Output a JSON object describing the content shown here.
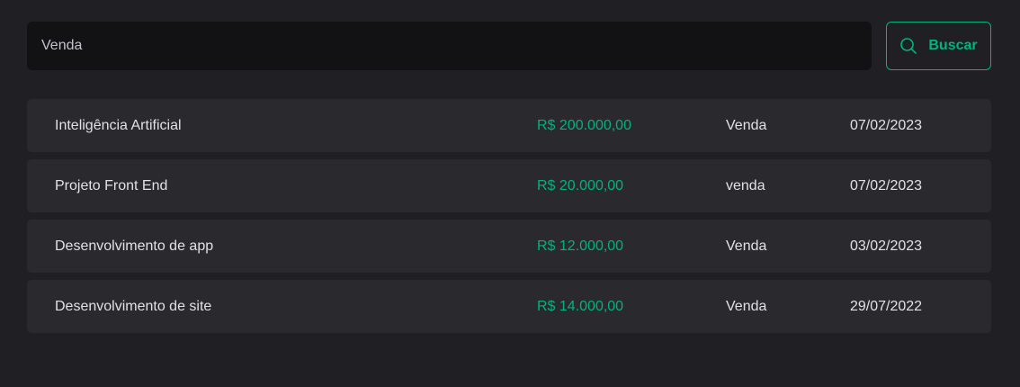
{
  "search": {
    "value": "Venda",
    "button_label": "Buscar",
    "button_icon": "search-icon"
  },
  "colors": {
    "background": "#202024",
    "input_background": "#121214",
    "row_background": "#29292e",
    "accent": "#00b37e",
    "text": "#e1e1e6"
  },
  "transactions": [
    {
      "description": "Inteligência Artificial",
      "price": "R$ 200.000,00",
      "category": "Venda",
      "date": "07/02/2023"
    },
    {
      "description": "Projeto Front End",
      "price": "R$ 20.000,00",
      "category": "venda",
      "date": "07/02/2023"
    },
    {
      "description": "Desenvolvimento de app",
      "price": "R$ 12.000,00",
      "category": "Venda",
      "date": "03/02/2023"
    },
    {
      "description": "Desenvolvimento de site",
      "price": "R$ 14.000,00",
      "category": "Venda",
      "date": "29/07/2022"
    }
  ]
}
